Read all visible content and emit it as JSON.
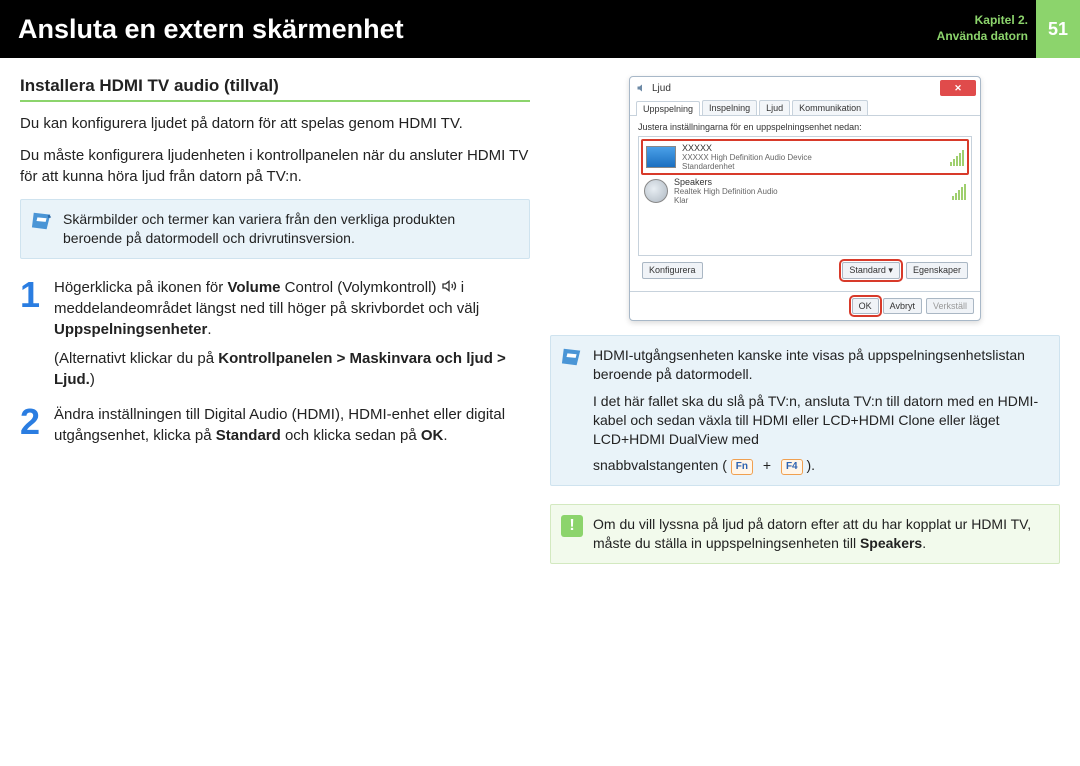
{
  "header": {
    "title": "Ansluta en extern skärmenhet",
    "chapter_line1": "Kapitel 2.",
    "chapter_line2": "Använda datorn",
    "page": "51"
  },
  "left": {
    "subhead": "Installera HDMI TV audio (tillval)",
    "p1": "Du kan konfigurera ljudet på datorn för att spelas genom HDMI TV.",
    "p2": "Du måste konfigurera ljudenheten i kontrollpanelen när du ansluter HDMI TV för att kunna höra ljud från datorn på TV:n.",
    "note": "Skärmbilder och termer kan variera från den verkliga produkten beroende på datormodell och drivrutinsversion.",
    "step1": {
      "pre": "Högerklicka på ikonen för ",
      "bold1": "Volume",
      "mid": " Control (Volymkontroll) ",
      "after": " i meddelandeområdet längst ned till höger på skrivbordet och välj ",
      "bold2": "Uppspelningsenheter",
      "dot": ".",
      "alt_pre": "(Alternativt klickar du på ",
      "alt_bold": "Kontrollpanelen > Maskinvara och ljud > Ljud.",
      "alt_post": ")"
    },
    "step2": {
      "pre": "Ändra inställningen till Digital Audio (HDMI), HDMI-enhet eller digital utgångsenhet, klicka på ",
      "b1": "Standard",
      "mid": " och klicka sedan på ",
      "b2": "OK",
      "dot": "."
    }
  },
  "right": {
    "note1_a": "HDMI-utgångsenheten kanske inte visas på uppspelningsenhetslistan beroende på datormodell.",
    "note1_b": "I det här fallet ska du slå på TV:n, ansluta TV:n till datorn med en HDMI-kabel och sedan växla till HDMI eller LCD+HDMI Clone eller läget LCD+HDMI DualView med",
    "note1_c_pre": "snabbvalstangenten (",
    "key1": "Fn",
    "key2": "F4",
    "note1_c_post": ").",
    "alert_pre": "Om du vill lyssna på ljud på datorn efter att du har kopplat ur HDMI TV, måste du ställa in uppspelningsenheten till ",
    "alert_bold": "Speakers",
    "alert_dot": "."
  },
  "dlg": {
    "title": "Ljud",
    "tabs": [
      "Uppspelning",
      "Inspelning",
      "Ljud",
      "Kommunikation"
    ],
    "instr": "Justera inställningarna för en uppspelningsenhet nedan:",
    "item1": {
      "name": "XXXXX",
      "sub": "XXXXX High Definition Audio Device",
      "status": "Standardenhet"
    },
    "item2": {
      "name": "Speakers",
      "sub": "Realtek High Definition Audio",
      "status": "Klar"
    },
    "btn_config": "Konfigurera",
    "btn_standard": "Standard",
    "btn_props": "Egenskaper",
    "btn_ok": "OK",
    "btn_cancel": "Avbryt",
    "btn_apply": "Verkställ",
    "close": "✕"
  }
}
